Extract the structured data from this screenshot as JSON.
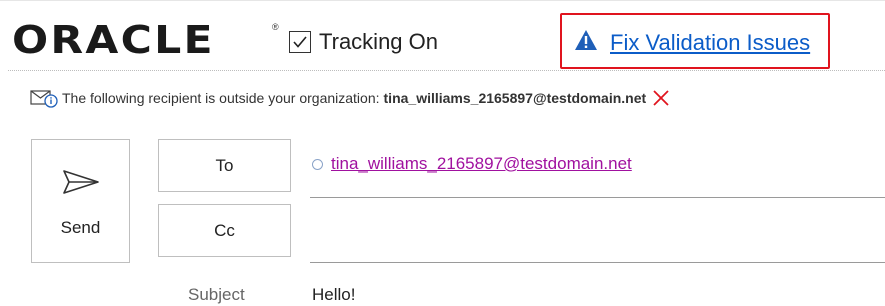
{
  "header": {
    "brand": "ORACLE",
    "registered_mark": "®",
    "tracking": {
      "label": "Tracking On",
      "checked": true
    },
    "validation": {
      "link_text": "Fix Validation Issues",
      "icon": "warning-triangle-icon"
    }
  },
  "notice": {
    "text": "The following recipient is outside your organization:",
    "address": "tina_williams_2165897@testdomain.net",
    "icon": "external-mail-info-icon",
    "dismiss_icon": "close-icon"
  },
  "compose": {
    "send_label": "Send",
    "to_label": "To",
    "cc_label": "Cc",
    "to_recipients": [
      "tina_williams_2165897@testdomain.net"
    ],
    "subject_label": "Subject",
    "subject_value": "Hello!"
  },
  "colors": {
    "highlight_border": "#e0141e",
    "link": "#0b5cc8",
    "recipient": "#a0119f",
    "dismiss": "#e0141e"
  }
}
